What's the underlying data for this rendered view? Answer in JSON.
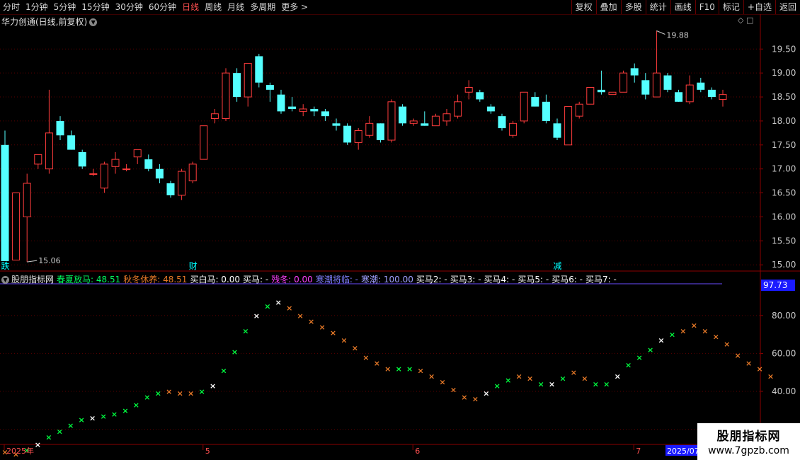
{
  "toolbar": {
    "periods": [
      "分时",
      "1分钟",
      "5分钟",
      "15分钟",
      "30分钟",
      "60分钟",
      "日线",
      "周线",
      "月线",
      "多周期",
      "更多 >"
    ],
    "active_period": "日线",
    "buttons": [
      "复权",
      "叠加",
      "多股",
      "统计",
      "画线",
      "F10",
      "标记",
      "+自选",
      "返回"
    ]
  },
  "title": "华力创通(日线,前复权)",
  "title_icon": "chevron-down-icon",
  "corner_icons": "◇ □",
  "price_axis": {
    "labels": [
      "19.50",
      "19.00",
      "18.50",
      "18.00",
      "17.50",
      "17.00",
      "16.50",
      "16.00",
      "15.50",
      "15.00"
    ],
    "values": [
      19.5,
      19.0,
      18.5,
      18.0,
      17.5,
      17.0,
      16.5,
      16.0,
      15.5,
      15.0
    ]
  },
  "annotations": {
    "high_label": "19.88",
    "low_label": "15.06",
    "markers": [
      {
        "text": "跌",
        "bar": 0,
        "color": "#00ffff"
      },
      {
        "text": "财",
        "bar": 17,
        "color": "#00ffff"
      },
      {
        "text": "减",
        "bar": 50,
        "color": "#00ffff"
      }
    ]
  },
  "chart_data": [
    {
      "type": "candlestick",
      "title": "华力创通(日线,前复权)",
      "ylim": [
        14.9,
        20.05
      ],
      "up_color": "#ff3c3c",
      "down_color": "#54ffff",
      "candles": [
        [
          17.5,
          17.8,
          15.1,
          15.06
        ],
        [
          15.1,
          16.5,
          15.1,
          16.5
        ],
        [
          16.0,
          16.9,
          15.06,
          16.7
        ],
        [
          17.1,
          17.3,
          17.0,
          17.3
        ],
        [
          17.0,
          18.65,
          16.9,
          17.75
        ],
        [
          18.0,
          18.1,
          17.6,
          17.7
        ],
        [
          17.7,
          17.8,
          17.4,
          17.4
        ],
        [
          17.35,
          17.4,
          17.0,
          17.05
        ],
        [
          16.9,
          17.0,
          16.85,
          16.9
        ],
        [
          16.6,
          17.15,
          16.5,
          17.1
        ],
        [
          17.05,
          17.35,
          16.9,
          17.2
        ],
        [
          17.0,
          17.1,
          16.95,
          17.0
        ],
        [
          17.25,
          17.4,
          17.1,
          17.4
        ],
        [
          17.2,
          17.3,
          16.95,
          17.0
        ],
        [
          17.0,
          17.1,
          16.7,
          16.8
        ],
        [
          16.7,
          16.75,
          16.4,
          16.45
        ],
        [
          16.45,
          17.0,
          16.35,
          16.95
        ],
        [
          16.75,
          17.15,
          16.7,
          17.1
        ],
        [
          17.2,
          17.9,
          17.2,
          17.9
        ],
        [
          18.05,
          18.25,
          17.95,
          18.15
        ],
        [
          18.05,
          19.1,
          18.0,
          19.0
        ],
        [
          19.0,
          19.1,
          18.4,
          18.5
        ],
        [
          18.5,
          19.2,
          18.3,
          19.2
        ],
        [
          19.35,
          19.4,
          18.7,
          18.8
        ],
        [
          18.75,
          18.8,
          18.4,
          18.65
        ],
        [
          18.55,
          18.65,
          18.15,
          18.2
        ],
        [
          18.3,
          18.5,
          18.2,
          18.25
        ],
        [
          18.2,
          18.35,
          18.1,
          18.25
        ],
        [
          18.25,
          18.3,
          18.1,
          18.2
        ],
        [
          18.2,
          18.25,
          18.0,
          18.1
        ],
        [
          17.95,
          18.05,
          17.8,
          17.9
        ],
        [
          17.9,
          17.95,
          17.5,
          17.55
        ],
        [
          17.55,
          17.85,
          17.4,
          17.8
        ],
        [
          17.7,
          18.1,
          17.65,
          17.95
        ],
        [
          17.95,
          17.95,
          17.55,
          17.6
        ],
        [
          17.6,
          18.45,
          17.55,
          18.4
        ],
        [
          18.3,
          18.35,
          17.9,
          17.95
        ],
        [
          17.95,
          18.05,
          17.9,
          18.0
        ],
        [
          17.95,
          18.2,
          17.9,
          17.9
        ],
        [
          17.9,
          18.15,
          17.9,
          18.1
        ],
        [
          18.0,
          18.25,
          17.9,
          18.15
        ],
        [
          18.1,
          18.55,
          18.05,
          18.4
        ],
        [
          18.6,
          18.85,
          18.45,
          18.7
        ],
        [
          18.6,
          18.65,
          18.4,
          18.45
        ],
        [
          18.3,
          18.35,
          18.15,
          18.2
        ],
        [
          18.1,
          18.15,
          17.8,
          17.85
        ],
        [
          17.7,
          18.0,
          17.65,
          17.95
        ],
        [
          18.0,
          18.6,
          17.95,
          18.6
        ],
        [
          18.5,
          18.6,
          18.3,
          18.3
        ],
        [
          18.4,
          18.55,
          17.95,
          18.0
        ],
        [
          17.95,
          18.05,
          17.6,
          17.65
        ],
        [
          17.5,
          18.3,
          17.5,
          18.3
        ],
        [
          18.1,
          18.4,
          18.05,
          18.35
        ],
        [
          18.35,
          18.7,
          18.35,
          18.7
        ],
        [
          18.65,
          19.05,
          18.55,
          18.6
        ],
        [
          18.55,
          18.6,
          18.55,
          18.6
        ],
        [
          18.6,
          19.05,
          18.6,
          19.0
        ],
        [
          19.1,
          19.2,
          18.8,
          18.95
        ],
        [
          18.85,
          19.0,
          18.45,
          18.55
        ],
        [
          18.5,
          19.88,
          18.5,
          19.0
        ],
        [
          18.95,
          19.0,
          18.6,
          18.65
        ],
        [
          18.6,
          18.65,
          18.4,
          18.4
        ],
        [
          18.4,
          18.95,
          18.35,
          18.75
        ],
        [
          18.8,
          18.9,
          18.6,
          18.65
        ],
        [
          18.65,
          18.7,
          18.45,
          18.5
        ],
        [
          18.45,
          18.65,
          18.3,
          18.55
        ]
      ]
    },
    {
      "type": "scatter",
      "title": "股朋指标网",
      "ylim": [
        12,
        96
      ],
      "y_axis_labels": [
        "80.00",
        "60.00",
        "40.00",
        "20.00"
      ],
      "y_axis_values": [
        80,
        60,
        40,
        20
      ],
      "current_label": "97.73",
      "series": [
        {
          "name": "春夏放马",
          "color": "#00ff40",
          "highlight_color": "#ffffff"
        },
        {
          "name": "秋冬休养",
          "color": "#e87a28"
        }
      ],
      "values": [
        8,
        7,
        9,
        12,
        16,
        19,
        22,
        25,
        26,
        27,
        28,
        30,
        33,
        37,
        39,
        40,
        39,
        39,
        40,
        43,
        51,
        61,
        72,
        80,
        85,
        87,
        84,
        80,
        77,
        74,
        71,
        67,
        63,
        58,
        55,
        52,
        52,
        52,
        51,
        48,
        45,
        41,
        37,
        36,
        39,
        43,
        46,
        48,
        47,
        44,
        44,
        47,
        50,
        47,
        44,
        44,
        48,
        54,
        58,
        62,
        67,
        70,
        72,
        75,
        72,
        69,
        65,
        59,
        55,
        52,
        48
      ],
      "kinds": [
        "o",
        "o",
        "g",
        "w",
        "g",
        "g",
        "g",
        "g",
        "w",
        "g",
        "g",
        "g",
        "g",
        "g",
        "g",
        "o",
        "o",
        "o",
        "g",
        "w",
        "g",
        "g",
        "g",
        "w",
        "g",
        "w",
        "o",
        "o",
        "o",
        "o",
        "o",
        "o",
        "o",
        "o",
        "o",
        "o",
        "g",
        "g",
        "o",
        "o",
        "o",
        "o",
        "o",
        "o",
        "w",
        "g",
        "g",
        "o",
        "o",
        "g",
        "w",
        "g",
        "o",
        "o",
        "g",
        "g",
        "w",
        "g",
        "g",
        "g",
        "w",
        "g",
        "o",
        "o",
        "o",
        "o",
        "o",
        "o",
        "o",
        "o",
        "o"
      ]
    }
  ],
  "indicator": {
    "name": "股朋指标网",
    "items": [
      {
        "label": "春夏放马: 48.51",
        "color": "#00ff60"
      },
      {
        "label": "秋冬休养: 48.51",
        "color": "#e87a28"
      },
      {
        "label": "买白马: 0.00",
        "color": "#ffffff"
      },
      {
        "label": "买马: -",
        "color": "#ffffff"
      },
      {
        "label": "残冬: 0.00",
        "color": "#ff40ff"
      },
      {
        "label": "寒潮将临: -",
        "color": "#8080ff"
      },
      {
        "label": "寒潮: 100.00",
        "color": "#a0a0ff"
      },
      {
        "label": "买马2: -",
        "color": "#ffffff"
      },
      {
        "label": "买马3: -",
        "color": "#ffffff"
      },
      {
        "label": "买马4: -",
        "color": "#ffffff"
      },
      {
        "label": "买马5: -",
        "color": "#ffffff"
      },
      {
        "label": "买马6: -",
        "color": "#ffffff"
      },
      {
        "label": "买马7: -",
        "color": "#ffffff"
      }
    ]
  },
  "date_axis": {
    "labels": [
      {
        "text": "2025年",
        "bar": 0
      },
      {
        "text": "5",
        "bar": 18
      },
      {
        "text": "6",
        "bar": 37
      },
      {
        "text": "7",
        "bar": 57
      }
    ],
    "current": "2025/07"
  },
  "logo": {
    "line1": "股朋指标网",
    "line2": "www.7gpzb.com"
  },
  "colors": {
    "grid": "#5a0000",
    "frame": "#8c0000",
    "axis_text": "#c8c8c8",
    "up": "#ff3c3c",
    "down": "#54ffff"
  }
}
